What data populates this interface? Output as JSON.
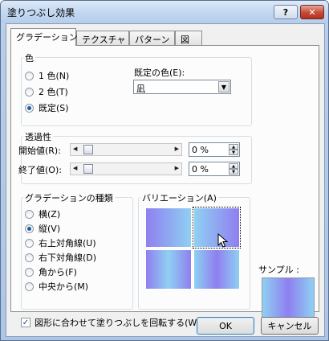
{
  "window": {
    "title": "塗りつぶし効果",
    "help": "?",
    "close": "✕"
  },
  "tabs": [
    "グラデーション",
    "テクスチャ",
    "パターン",
    "図"
  ],
  "color_group": {
    "legend": "色",
    "options": [
      "1 色(N)",
      "2 色(T)",
      "既定(S)"
    ],
    "selected_index": 2,
    "preset_label": "既定の色(E):",
    "preset_value": "凪"
  },
  "transparency": {
    "legend": "透過性",
    "start_label": "開始値(R):",
    "end_label": "終了値(O):",
    "start_value": "0 %",
    "end_value": "0 %",
    "start_fraction": 0,
    "end_fraction": 0
  },
  "gradient_type": {
    "legend": "グラデーションの種類",
    "options": [
      "横(Z)",
      "縦(V)",
      "右上対角線(U)",
      "右下対角線(D)",
      "角から(F)",
      "中央から(M)"
    ],
    "selected_index": 1
  },
  "variations": {
    "legend": "バリエーション(A)",
    "selected_index": 1
  },
  "sample": {
    "label": "サンプル :"
  },
  "rotate_checkbox": {
    "label": "図形に合わせて塗りつぶしを回転する(W)",
    "checked": true
  },
  "buttons": {
    "ok": "OK",
    "cancel": "キャンセル"
  },
  "colors": {
    "gradient_a": "#8f7ff0",
    "gradient_b": "#8fd0f2",
    "accent": "#1f5da6"
  }
}
